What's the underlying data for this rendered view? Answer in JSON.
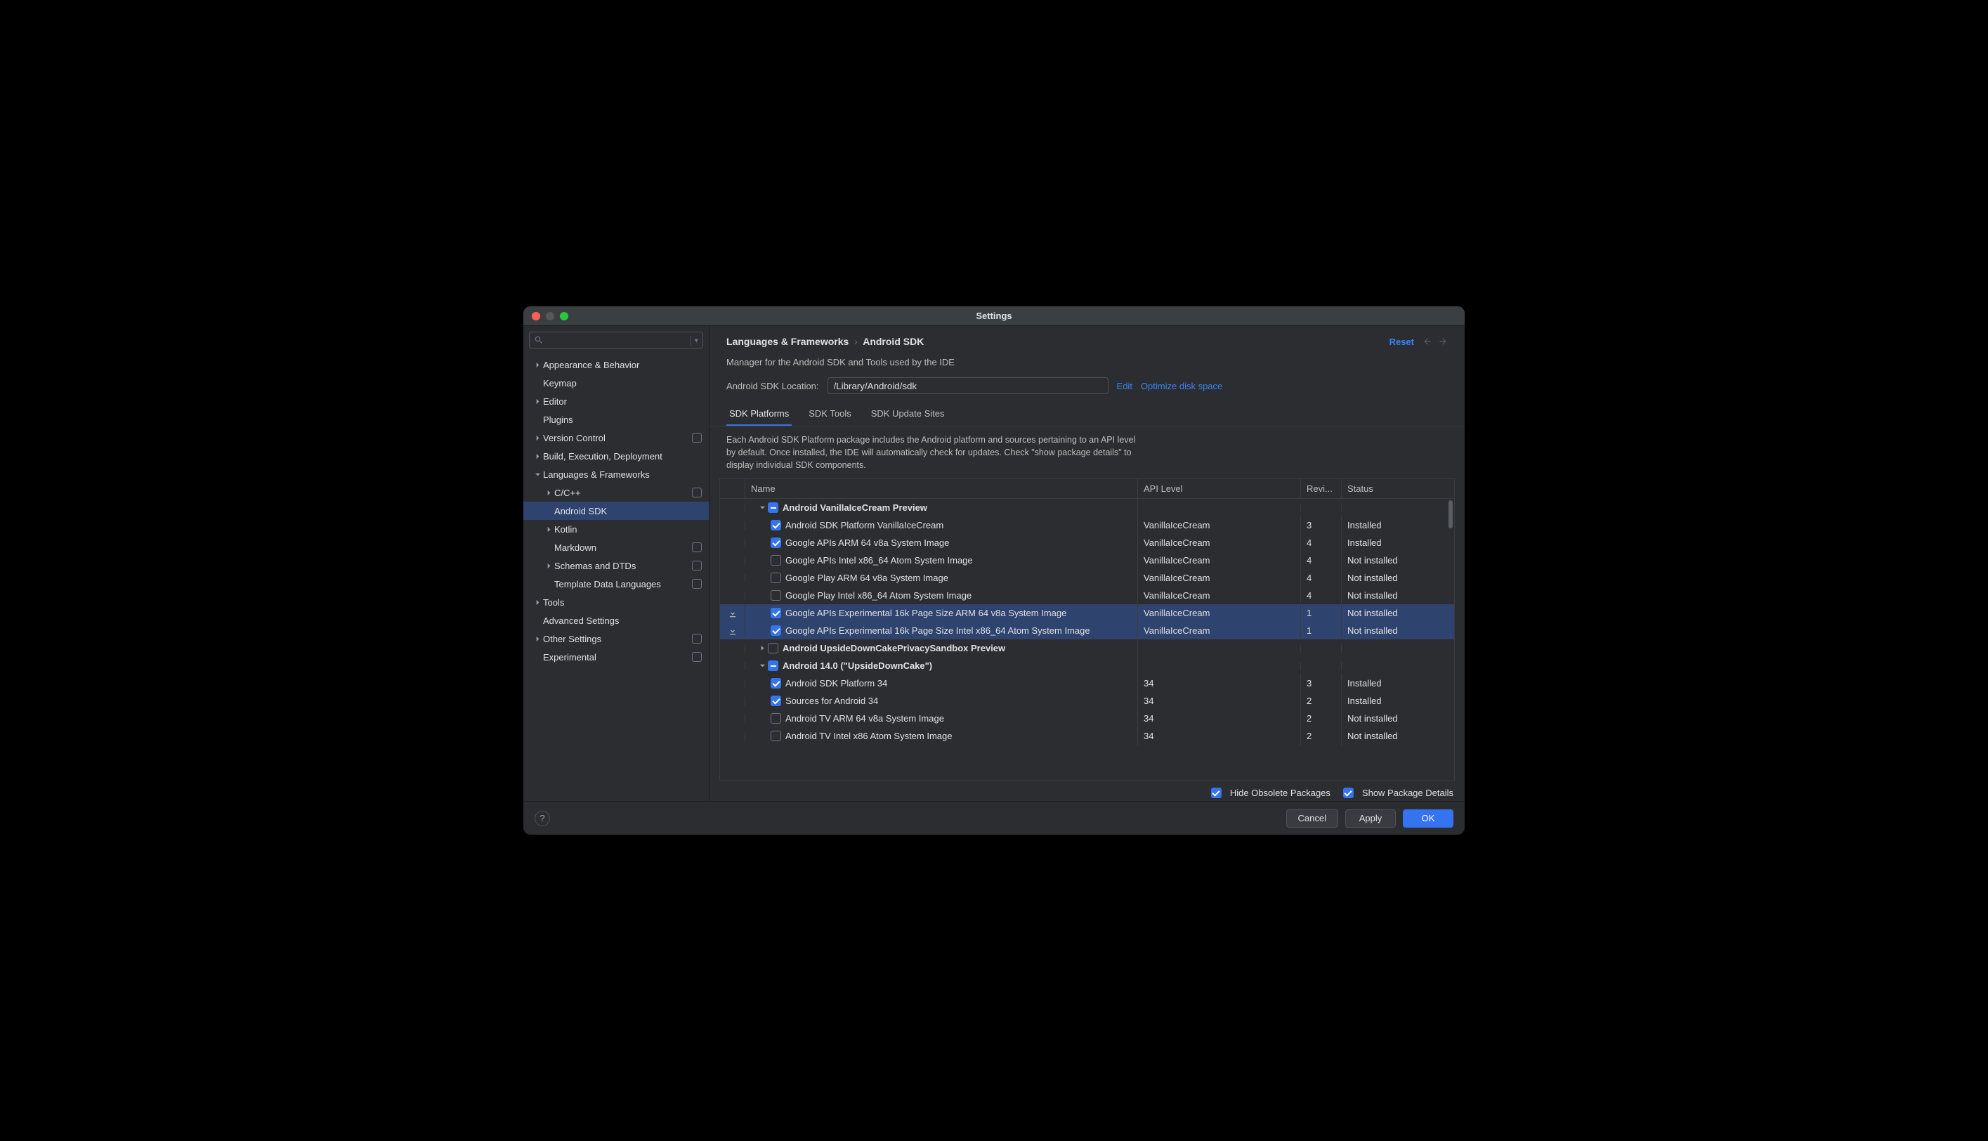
{
  "window_title": "Settings",
  "search_placeholder": "",
  "sidebar": [
    {
      "label": "Appearance & Behavior",
      "indent": 0,
      "expandable": true,
      "expanded": false
    },
    {
      "label": "Keymap",
      "indent": 0,
      "expandable": false
    },
    {
      "label": "Editor",
      "indent": 0,
      "expandable": true,
      "expanded": false
    },
    {
      "label": "Plugins",
      "indent": 0,
      "expandable": false
    },
    {
      "label": "Version Control",
      "indent": 0,
      "expandable": true,
      "expanded": false,
      "modified": true
    },
    {
      "label": "Build, Execution, Deployment",
      "indent": 0,
      "expandable": true,
      "expanded": false
    },
    {
      "label": "Languages & Frameworks",
      "indent": 0,
      "expandable": true,
      "expanded": true
    },
    {
      "label": "C/C++",
      "indent": 1,
      "expandable": true,
      "expanded": false,
      "modified": true
    },
    {
      "label": "Android SDK",
      "indent": 1,
      "expandable": false,
      "selected": true
    },
    {
      "label": "Kotlin",
      "indent": 1,
      "expandable": true,
      "expanded": false
    },
    {
      "label": "Markdown",
      "indent": 1,
      "expandable": false,
      "modified": true
    },
    {
      "label": "Schemas and DTDs",
      "indent": 1,
      "expandable": true,
      "expanded": false,
      "modified": true
    },
    {
      "label": "Template Data Languages",
      "indent": 1,
      "expandable": false,
      "modified": true
    },
    {
      "label": "Tools",
      "indent": 0,
      "expandable": true,
      "expanded": false
    },
    {
      "label": "Advanced Settings",
      "indent": 0,
      "expandable": false
    },
    {
      "label": "Other Settings",
      "indent": 0,
      "expandable": true,
      "expanded": false,
      "modified": true
    },
    {
      "label": "Experimental",
      "indent": 0,
      "expandable": false,
      "modified": true
    }
  ],
  "breadcrumb": {
    "a": "Languages & Frameworks",
    "b": "Android SDK"
  },
  "reset": "Reset",
  "description": "Manager for the Android SDK and Tools used by the IDE",
  "location_label": "Android SDK Location:",
  "location_value": "/Library/Android/sdk",
  "edit_link": "Edit",
  "optimize_link": "Optimize disk space",
  "tabs": [
    "SDK Platforms",
    "SDK Tools",
    "SDK Update Sites"
  ],
  "active_tab": 0,
  "infotext": "Each Android SDK Platform package includes the Android platform and sources pertaining to an API level by default. Once installed, the IDE will automatically check for updates. Check \"show package details\" to display individual SDK components.",
  "columns": {
    "name": "Name",
    "api": "API Level",
    "rev": "Revi...",
    "status": "Status"
  },
  "rows": [
    {
      "type": "group",
      "name": "Android VanillaIceCream Preview",
      "check": "mixed",
      "expanded": true,
      "indent": 0
    },
    {
      "type": "item",
      "name": "Android SDK Platform VanillaIceCream",
      "check": "checked",
      "api": "VanillaIceCream",
      "rev": "3",
      "status": "Installed",
      "indent": 1
    },
    {
      "type": "item",
      "name": "Google APIs ARM 64 v8a System Image",
      "check": "checked",
      "api": "VanillaIceCream",
      "rev": "4",
      "status": "Installed",
      "indent": 1
    },
    {
      "type": "item",
      "name": "Google APIs Intel x86_64 Atom System Image",
      "check": "",
      "api": "VanillaIceCream",
      "rev": "4",
      "status": "Not installed",
      "indent": 1
    },
    {
      "type": "item",
      "name": "Google Play ARM 64 v8a System Image",
      "check": "",
      "api": "VanillaIceCream",
      "rev": "4",
      "status": "Not installed",
      "indent": 1
    },
    {
      "type": "item",
      "name": "Google Play Intel x86_64 Atom System Image",
      "check": "",
      "api": "VanillaIceCream",
      "rev": "4",
      "status": "Not installed",
      "indent": 1
    },
    {
      "type": "item",
      "name": "Google APIs Experimental 16k Page Size ARM 64 v8a System Image",
      "check": "checked",
      "api": "VanillaIceCream",
      "rev": "1",
      "status": "Not installed",
      "indent": 1,
      "selected": true,
      "dl": true
    },
    {
      "type": "item",
      "name": "Google APIs Experimental 16k Page Size Intel x86_64 Atom System Image",
      "check": "checked",
      "api": "VanillaIceCream",
      "rev": "1",
      "status": "Not installed",
      "indent": 1,
      "selected": true,
      "dl": true
    },
    {
      "type": "group",
      "name": "Android UpsideDownCakePrivacySandbox Preview",
      "check": "",
      "expanded": false,
      "indent": 0
    },
    {
      "type": "group",
      "name": "Android 14.0 (\"UpsideDownCake\")",
      "check": "mixed",
      "expanded": true,
      "indent": 0
    },
    {
      "type": "item",
      "name": "Android SDK Platform 34",
      "check": "checked",
      "api": "34",
      "rev": "3",
      "status": "Installed",
      "indent": 1
    },
    {
      "type": "item",
      "name": "Sources for Android 34",
      "check": "checked",
      "api": "34",
      "rev": "2",
      "status": "Installed",
      "indent": 1
    },
    {
      "type": "item",
      "name": "Android TV ARM 64 v8a System Image",
      "check": "",
      "api": "34",
      "rev": "2",
      "status": "Not installed",
      "indent": 1
    },
    {
      "type": "item",
      "name": "Android TV Intel x86 Atom System Image",
      "check": "",
      "api": "34",
      "rev": "2",
      "status": "Not installed",
      "indent": 1
    }
  ],
  "hide_obsolete": {
    "label": "Hide Obsolete Packages",
    "checked": true
  },
  "show_details": {
    "label": "Show Package Details",
    "checked": true
  },
  "buttons": {
    "cancel": "Cancel",
    "apply": "Apply",
    "ok": "OK"
  }
}
